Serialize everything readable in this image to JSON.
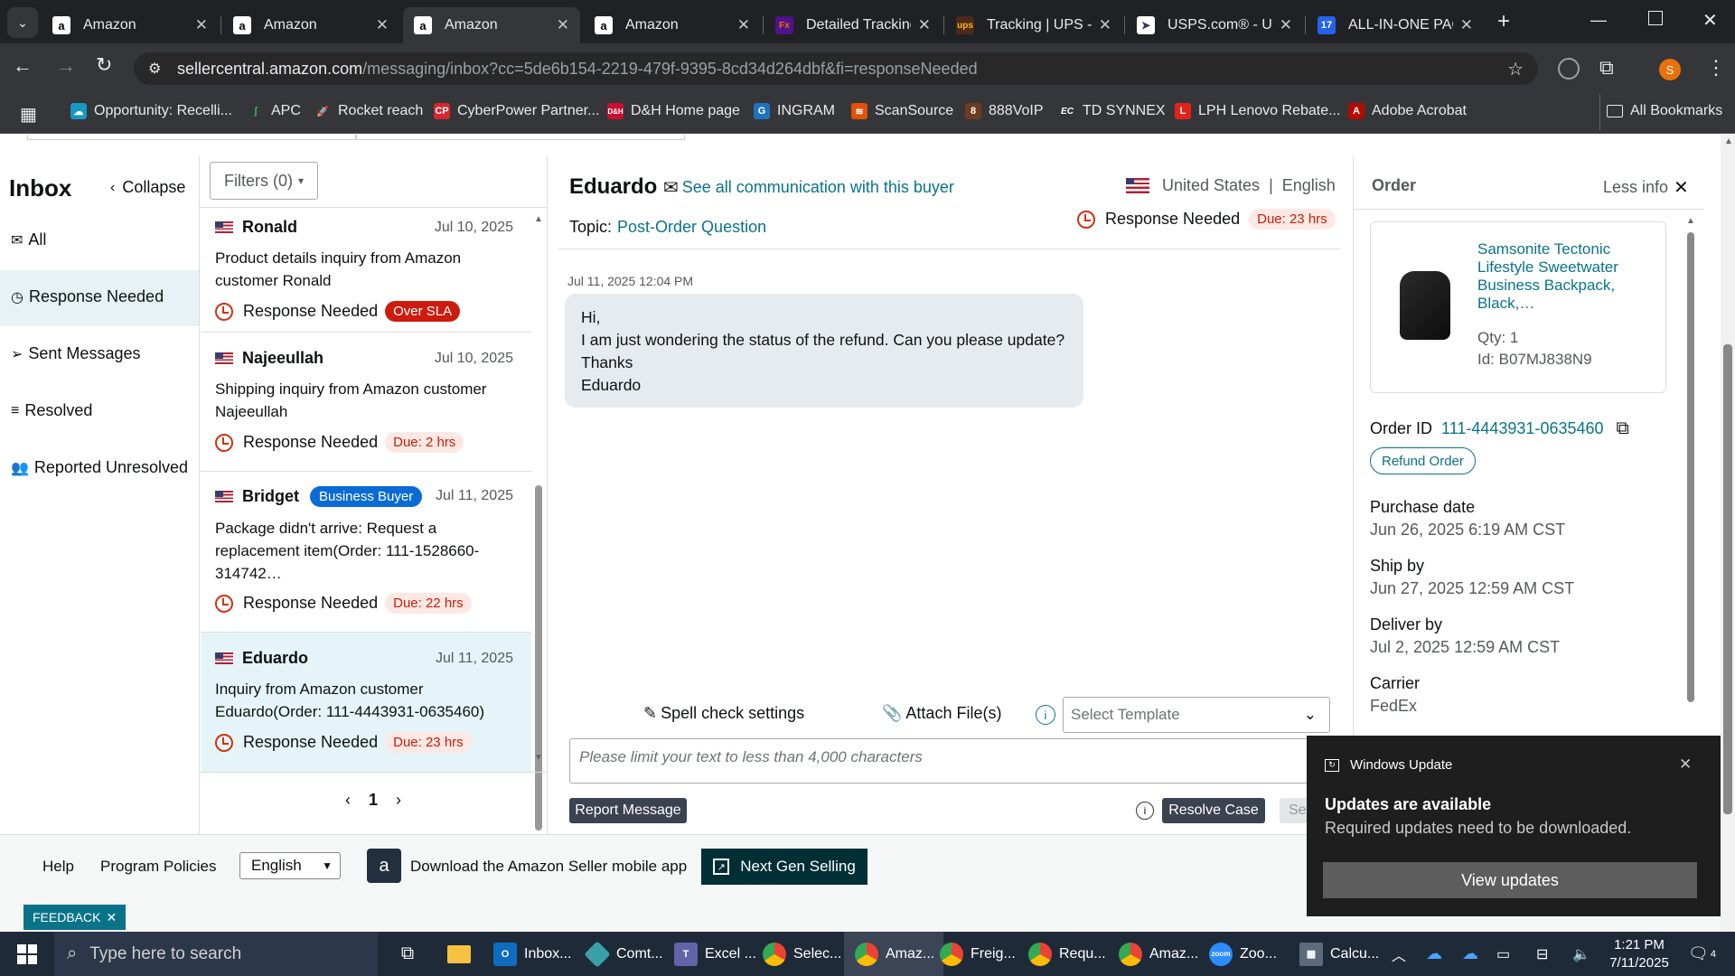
{
  "browser": {
    "tabs": [
      {
        "title": "Amazon",
        "icon": "amazon-icon"
      },
      {
        "title": "Amazon",
        "icon": "amazon-icon"
      },
      {
        "title": "Amazon",
        "icon": "amazon-icon"
      },
      {
        "title": "Amazon",
        "icon": "amazon-icon"
      },
      {
        "title": "Detailed Tracking",
        "icon": "fedex-icon"
      },
      {
        "title": "Tracking | UPS - U",
        "icon": "ups-icon"
      },
      {
        "title": "USPS.com® - US",
        "icon": "usps-icon"
      },
      {
        "title": "ALL-IN-ONE PAC",
        "icon": "seventeen-track-icon"
      }
    ],
    "url_host": "sellercentral.amazon.com",
    "url_path": "/messaging/inbox?cc=5de6b154-2219-479f-9395-8cd34d264dbf&fi=responseNeeded",
    "profile_initial": "S",
    "bookmarks": [
      "Opportunity: Recelli...",
      "APC",
      "Rocket reach",
      "CyberPower Partner...",
      "D&H Home page",
      "INGRAM",
      "ScanSource",
      "888VoIP",
      "TD SYNNEX",
      "LPH Lenovo Rebate...",
      "Adobe Acrobat"
    ],
    "all_bookmarks": "All Bookmarks"
  },
  "sidebar": {
    "title": "Inbox",
    "collapse": "Collapse",
    "items": [
      "All",
      "Response Needed",
      "Sent Messages",
      "Resolved",
      "Reported Unresolved"
    ]
  },
  "filters": "Filters (0)",
  "messages": [
    {
      "name": "Ronald",
      "date": "Jul 10, 2025",
      "body": "Product details inquiry from Amazon customer Ronald",
      "status": "Response Needed",
      "badge": "Over SLA"
    },
    {
      "name": "Najeeullah",
      "date": "Jul 10, 2025",
      "body": "Shipping inquiry from Amazon customer Najeeullah",
      "status": "Response Needed",
      "badge": "Due: 2 hrs"
    },
    {
      "name": "Bridget",
      "tag": "Business Buyer",
      "date": "Jul 11, 2025",
      "body": "Package didn't arrive: Request a replacement item(Order: 111-1528660-314742…",
      "status": "Response Needed",
      "badge": "Due: 22 hrs"
    },
    {
      "name": "Eduardo",
      "date": "Jul 11, 2025",
      "body": "Inquiry from Amazon customer Eduardo(Order: 111-4443931-0635460)",
      "status": "Response Needed",
      "badge": "Due: 23 hrs"
    }
  ],
  "pagination": {
    "page": "1"
  },
  "conversation": {
    "buyer": "Eduardo",
    "see_all": "See all communication with this buyer",
    "country": "United States",
    "language": "English",
    "topic_label": "Topic:",
    "topic": "Post-Order Question",
    "status": "Response Needed",
    "due": "Due: 23 hrs",
    "timestamp": "Jul 11, 2025 12:04 PM",
    "message_lines": [
      "Hi,",
      "I am just wondering the status of the refund. Can you please update?",
      "Thanks",
      "Eduardo"
    ],
    "spell_check": "Spell check settings",
    "attach": "Attach File(s)",
    "template_placeholder": "Select Template",
    "reply_placeholder": "Please limit your text to less than 4,000 characters",
    "report": "Report Message",
    "resolve": "Resolve Case",
    "send_partial": "Se"
  },
  "order": {
    "header": "Order",
    "less_info": "Less info",
    "product_title": "Samsonite Tectonic Lifestyle Sweetwater Business Backpack, Black,…",
    "qty": "Qty: 1",
    "id": "Id: B07MJ838N9",
    "order_id_label": "Order ID",
    "order_id": "111-4443931-0635460",
    "refund": "Refund Order",
    "purchase_label": "Purchase date",
    "purchase": "Jun 26, 2025 6:19 AM CST",
    "ship_label": "Ship by",
    "ship": "Jun 27, 2025 12:59 AM CST",
    "deliver_label": "Deliver by",
    "deliver": "Jul 2, 2025 12:59 AM CST",
    "carrier_label": "Carrier",
    "carrier": "FedEx"
  },
  "footer": {
    "help": "Help",
    "policies": "Program Policies",
    "language": "English",
    "app": "Download the Amazon Seller mobile app",
    "nextgen": "Next Gen Selling",
    "feedback": "FEEDBACK"
  },
  "toast": {
    "app": "Windows Update",
    "title": "Updates are available",
    "body": "Required updates need to be downloaded.",
    "action": "View updates"
  },
  "taskbar": {
    "search": "Type here to search",
    "apps": [
      "Inbox...",
      "Comt...",
      "Excel ...",
      "Selec...",
      "Amaz...",
      "Freig...",
      "Requ...",
      "Amaz...",
      "Zoo...",
      "Calcu..."
    ],
    "time": "1:21 PM",
    "date": "7/11/2025",
    "notifications": "4"
  },
  "colors": {
    "accent": "#0a7389",
    "alert": "#cc1c0e",
    "selected_row": "#e5f4f8",
    "nav_selected": "#e6f2f6"
  }
}
